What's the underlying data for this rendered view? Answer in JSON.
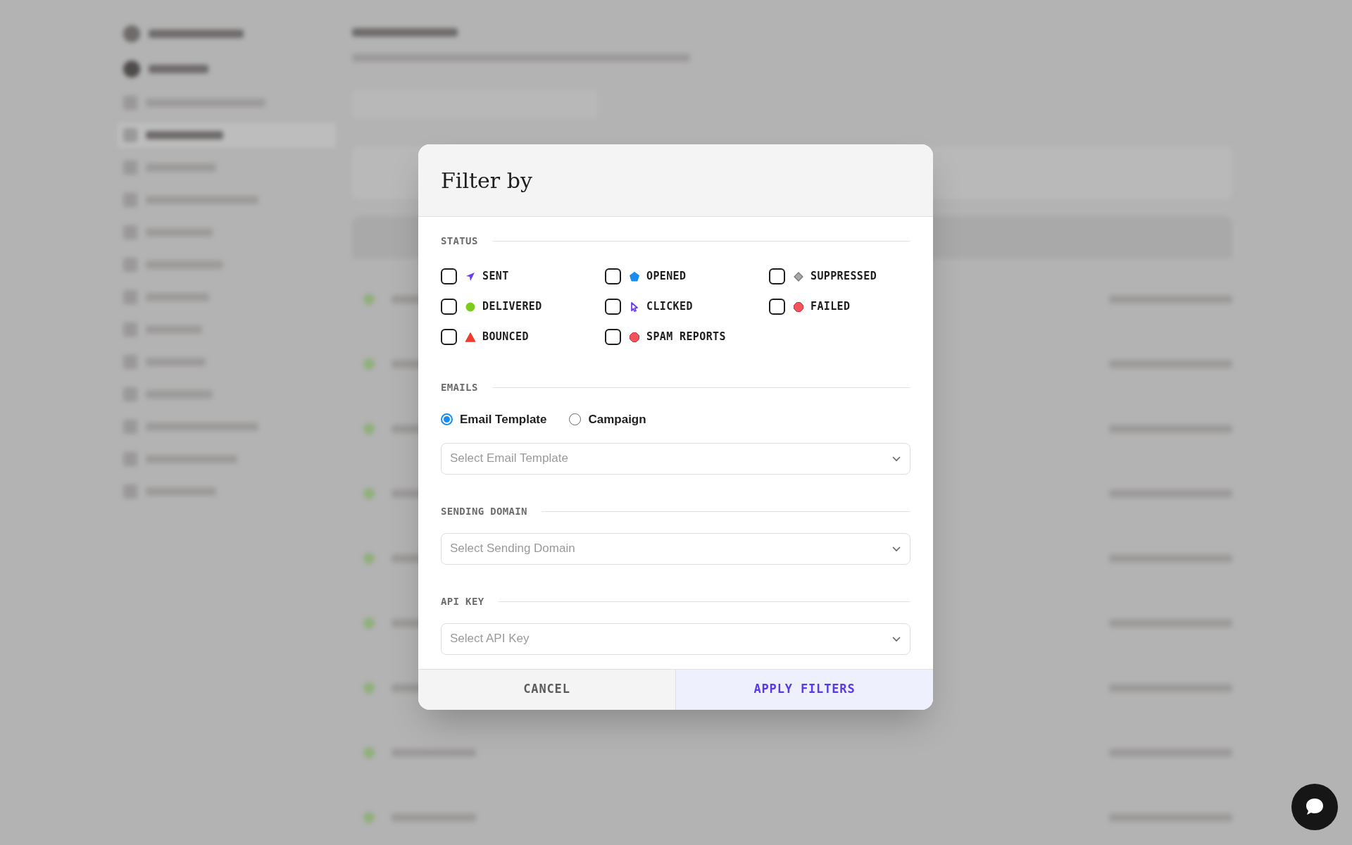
{
  "dialog": {
    "title": "Filter by",
    "status": {
      "heading": "STATUS",
      "items": [
        {
          "label": "SENT",
          "kind": "plane",
          "color": "#6a3cf5",
          "checked": false
        },
        {
          "label": "OPENED",
          "kind": "pentagon",
          "color": "#1a8cf0",
          "checked": false
        },
        {
          "label": "SUPPRESSED",
          "kind": "diamond",
          "color": "#a8a8a8",
          "checked": false
        },
        {
          "label": "DELIVERED",
          "kind": "circle",
          "color": "#7ccc1c",
          "checked": false
        },
        {
          "label": "CLICKED",
          "kind": "cursor",
          "color": "#6a3cf5",
          "checked": false
        },
        {
          "label": "FAILED",
          "kind": "octagon",
          "color": "#f2545b",
          "checked": false
        },
        {
          "label": "BOUNCED",
          "kind": "triangle",
          "color": "#f03a2e",
          "checked": false
        },
        {
          "label": "SPAM REPORTS",
          "kind": "octagon",
          "color": "#f2545b",
          "checked": false
        }
      ]
    },
    "emails": {
      "heading": "EMAILS",
      "options": [
        {
          "label": "Email Template",
          "selected": true
        },
        {
          "label": "Campaign",
          "selected": false
        }
      ],
      "select": {
        "placeholder": "Select Email Template"
      }
    },
    "sending_domain": {
      "heading": "SENDING DOMAIN",
      "select": {
        "placeholder": "Select Sending Domain"
      }
    },
    "api_key": {
      "heading": "API KEY",
      "select": {
        "placeholder": "Select API Key"
      }
    },
    "buttons": [
      {
        "label": "CANCEL",
        "kind": "secondary"
      },
      {
        "label": "APPLY FILTERS",
        "kind": "primary"
      }
    ]
  }
}
